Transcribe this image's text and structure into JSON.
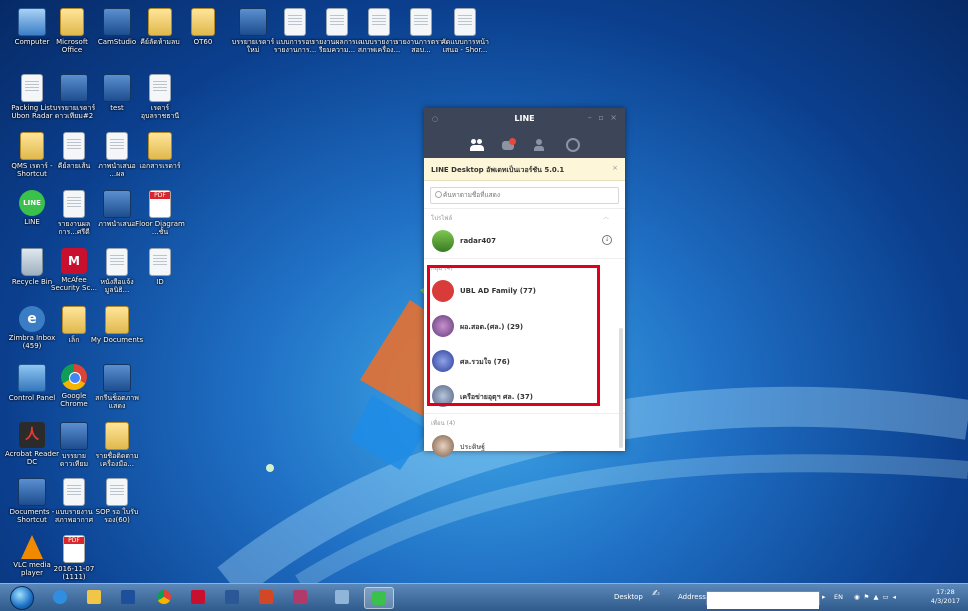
{
  "desktop_icons": [
    {
      "label": "Computer",
      "icon": "computer-icon"
    },
    {
      "label": "Microsoft Office",
      "icon": "folder-icon"
    },
    {
      "label": "CamStudio",
      "icon": "app-icon"
    },
    {
      "label": "คีย์ลัดห้ามลบ",
      "icon": "folder-icon"
    },
    {
      "label": "OT60",
      "icon": "folder-icon"
    },
    {
      "label": "บรรยายเรดาร์ใหม่",
      "icon": "app-icon"
    },
    {
      "label": "แบบการรอบรายงานการ...",
      "icon": "document-icon"
    },
    {
      "label": "รายงานผลการเตรียมความ...",
      "icon": "document-icon"
    },
    {
      "label": "แบบรายงานสภาพเครื่อง...",
      "icon": "document-icon"
    },
    {
      "label": "รายงานการตรวจสอบ...",
      "icon": "document-icon"
    },
    {
      "label": "คัดแบบการหน้าเสนอ - Shor...",
      "icon": "document-icon"
    },
    {
      "label": "Packing List Ubon Radar",
      "icon": "spreadsheet-icon"
    },
    {
      "label": "บรรยายเรดาร์ ดาวเทียม#2",
      "icon": "app-icon"
    },
    {
      "label": "test",
      "icon": "image-icon"
    },
    {
      "label": "เรดาร์ อุบลราชธานี",
      "icon": "document-icon"
    },
    {
      "label": "QMS เรดาร์ - Shortcut",
      "icon": "folder-icon"
    },
    {
      "label": "คีย์ลายเส้น",
      "icon": "document-icon"
    },
    {
      "label": "ภาพนำเสนอ ...ผล",
      "icon": "document-icon"
    },
    {
      "label": "เอกสารเรดาร์",
      "icon": "folder-icon"
    },
    {
      "label": "LINE",
      "icon": "line-icon"
    },
    {
      "label": "รายงานผลการ...ศรีดี",
      "icon": "document-icon"
    },
    {
      "label": "ภาพนำเสนอ",
      "icon": "app-icon"
    },
    {
      "label": "Floor Diagram ...ชั้น",
      "icon": "pdf-icon"
    },
    {
      "label": "Recycle Bin",
      "icon": "recycle-bin-icon"
    },
    {
      "label": "McAfee Security Sc...",
      "icon": "mcafee-icon"
    },
    {
      "label": "หนังสือแจ้ง มูลนิธิ...",
      "icon": "document-icon"
    },
    {
      "label": "ID",
      "icon": "document-icon"
    },
    {
      "label": "Zimbra Inbox (459)",
      "icon": "zimbra-icon"
    },
    {
      "label": "เล็ก",
      "icon": "folder-icon"
    },
    {
      "label": "My Documents",
      "icon": "folder-icon"
    },
    {
      "label": "Control Panel",
      "icon": "control-panel-icon"
    },
    {
      "label": "Google Chrome",
      "icon": "chrome-icon"
    },
    {
      "label": "สกรีนช็อตภาพ แสดง",
      "icon": "image-icon"
    },
    {
      "label": "Acrobat Reader DC",
      "icon": "acrobat-icon"
    },
    {
      "label": "บรรยาย ดาวเทียม",
      "icon": "app-icon"
    },
    {
      "label": "รายชื่อติดตามเครื่องมือ...",
      "icon": "folder-icon"
    },
    {
      "label": "Documents - Shortcut",
      "icon": "app-icon"
    },
    {
      "label": "แบบรายงาน สภาพอากาศ",
      "icon": "document-icon"
    },
    {
      "label": "SOP รอ ใบรับรอง(60)",
      "icon": "document-icon"
    },
    {
      "label": "VLC media player",
      "icon": "vlc-icon"
    },
    {
      "label": "2016-11-07 (1111)",
      "icon": "pdf-icon"
    }
  ],
  "line_window": {
    "title": "LINE",
    "window_controls": "– ▫ ×",
    "tabs": [
      "friends-tab",
      "chats-tab",
      "add-friend-tab",
      "more-tab"
    ],
    "update_notice": "LINE Desktop อัพเดทเป็นเวอร์ชัน 5.0.1",
    "close_notice": "×",
    "search_placeholder": "ค้นหาตามชื่อที่แสดง",
    "profile_section": "โปรไฟล์",
    "profile_name": "radar407",
    "groups_section": "กลุ่ม (4)",
    "groups": [
      {
        "name": "UBL AD Family (77)",
        "avatar_color": "#d93a3a"
      },
      {
        "name": "ผอ.สอต.(ศล.) (29)",
        "avatar_color": "#7b5e9c"
      },
      {
        "name": "ศล.รวมใจ (76)",
        "avatar_color": "#3a4ea8"
      },
      {
        "name": "เครือข่ายอุตุฯ ศล. (37)",
        "avatar_color": "#6a7ea0"
      }
    ],
    "friends_section": "เพื่อน (4)",
    "friend_name": "ประดิษฐ์"
  },
  "taskbar": {
    "desktop_label": "Desktop",
    "address_label": "Address",
    "language": "EN",
    "time": "17:28",
    "date": "4/3/2017"
  },
  "colors": {
    "highlight": "#e0001b",
    "line_green": "#3ac14b",
    "line_header": "#3d4558"
  }
}
